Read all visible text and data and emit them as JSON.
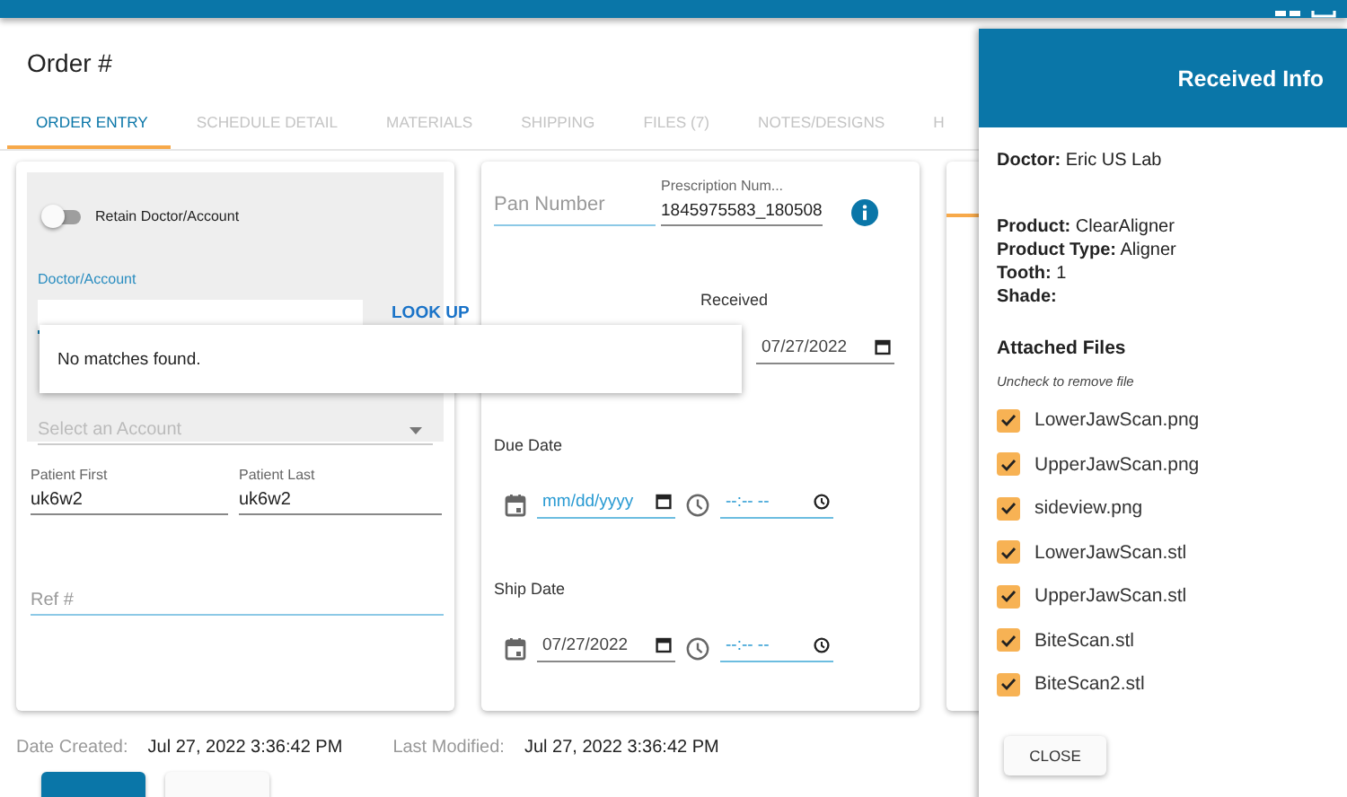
{
  "page": {
    "title": "Order #"
  },
  "tabs": [
    {
      "label": "ORDER ENTRY",
      "selected": true
    },
    {
      "label": "SCHEDULE DETAIL",
      "selected": false
    },
    {
      "label": "MATERIALS",
      "selected": false
    },
    {
      "label": "SHIPPING",
      "selected": false
    },
    {
      "label": "FILES (7)",
      "selected": false
    },
    {
      "label": "NOTES/DESIGNS",
      "selected": false
    },
    {
      "label": "H",
      "selected": false
    }
  ],
  "account_panel": {
    "retain_toggle": {
      "label": "Retain Doctor/Account",
      "on": false
    },
    "doctor_field": {
      "label": "Doctor/Account"
    },
    "lookup_button": "LOOK UP",
    "suggestions": {
      "message": "No matches found."
    },
    "account_select": {
      "placeholder": "Select an Account"
    }
  },
  "patient_first": {
    "label": "Patient First",
    "value": "uk6w2"
  },
  "patient_last": {
    "label": "Patient Last",
    "value": "uk6w2"
  },
  "ref_field": {
    "placeholder": "Ref #"
  },
  "pan_field": {
    "placeholder": "Pan Number"
  },
  "prescription_field": {
    "label": "Prescription Num...",
    "value": "1845975583_180508"
  },
  "received": {
    "label": "Received",
    "date": "07/27/2022"
  },
  "due_date": {
    "label": "Due Date",
    "date_placeholder": "mm/dd/yyyy",
    "time_placeholder": "--:-- --"
  },
  "ship_date": {
    "label": "Ship Date",
    "date": "07/27/2022",
    "time_placeholder": "--:-- --"
  },
  "footer": {
    "created_label": "Date Created:",
    "created_value": "Jul 27, 2022 3:36:42 PM",
    "modified_label": "Last Modified:",
    "modified_value": "Jul 27, 2022 3:36:42 PM"
  },
  "drawer": {
    "title": "Received Info",
    "doctor": {
      "label": "Doctor:",
      "value": "Eric US Lab"
    },
    "product_lines": [
      {
        "label": "Product:",
        "value": "ClearAligner"
      },
      {
        "label": "Product Type:",
        "value": "Aligner"
      },
      {
        "label": "Tooth:",
        "value": "1"
      },
      {
        "label": "Shade:"
      }
    ],
    "files_title": "Attached Files",
    "files_hint": "Uncheck to remove file",
    "files": [
      {
        "name": "LowerJawScan.png",
        "checked": true
      },
      {
        "name": "UpperJawScan.png",
        "checked": true
      },
      {
        "name": "sideview.png",
        "checked": true
      },
      {
        "name": "LowerJawScan.stl",
        "checked": true
      },
      {
        "name": "UpperJawScan.stl",
        "checked": true
      },
      {
        "name": "BiteScan.stl",
        "checked": true
      },
      {
        "name": "BiteScan2.stl",
        "checked": true
      }
    ],
    "close_button": "CLOSE"
  }
}
